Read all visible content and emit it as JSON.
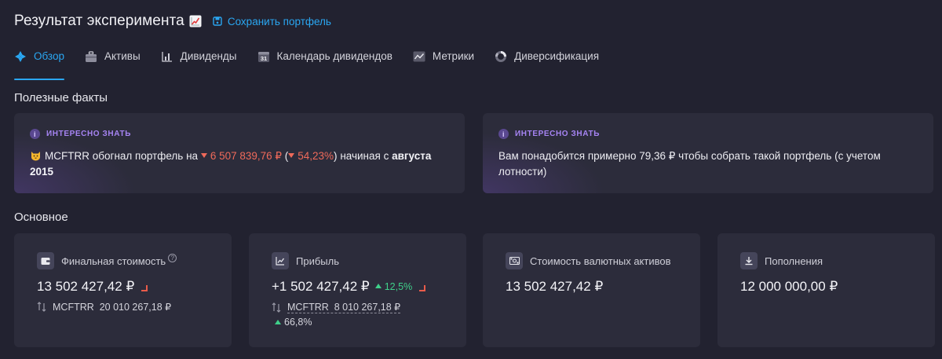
{
  "header": {
    "title": "Результат эксперимента",
    "title_icon": "chart-increasing-emoji",
    "save_label": "Сохранить портфель"
  },
  "tabs": [
    {
      "label": "Обзор",
      "icon": "overview-icon",
      "active": true
    },
    {
      "label": "Активы",
      "icon": "briefcase-icon",
      "active": false
    },
    {
      "label": "Дивиденды",
      "icon": "bar-chart-icon",
      "active": false
    },
    {
      "label": "Календарь дивидендов",
      "icon": "calendar-icon",
      "calendar_day": "31",
      "active": false
    },
    {
      "label": "Метрики",
      "icon": "line-chart-icon",
      "active": false
    },
    {
      "label": "Диверсификация",
      "icon": "donut-chart-icon",
      "active": false
    }
  ],
  "facts": {
    "title": "Полезные факты",
    "cards": [
      {
        "label": "ИНТЕРЕСНО ЗНАТЬ",
        "emoji": "cat-emoji",
        "ticker": "MCFTRR",
        "text1": "обогнал портфель на",
        "amount": "6 507 839,76 ₽",
        "paren_open": "(",
        "percent": "54,23%",
        "paren_close": ")",
        "text2": "начиная с",
        "date": "августа 2015"
      },
      {
        "label": "ИНТЕРЕСНО ЗНАТЬ",
        "text": "Вам понадобится примерно 79,36 ₽ чтобы собрать такой портфель (с учетом лотности)"
      }
    ]
  },
  "main": {
    "title": "Основное",
    "cards": [
      {
        "title": "Финальная стоимость",
        "help": "?",
        "value": "13 502 427,42 ₽",
        "bench_ticker": "MCFTRR",
        "bench_value": "20 010 267,18 ₽"
      },
      {
        "title": "Прибыль",
        "value": "+1 502 427,42 ₽",
        "change": "12,5%",
        "bench_ticker": "MCFTRR",
        "bench_value": "8 010 267,18 ₽",
        "bench_change": "66,8%"
      },
      {
        "title": "Стоимость валютных активов",
        "value": "13 502 427,42 ₽"
      },
      {
        "title": "Пополнения",
        "value": "12 000 000,00 ₽"
      }
    ]
  },
  "colors": {
    "accent": "#2aa7f2",
    "negative": "#ef6a5a",
    "positive": "#3fd08a",
    "info_label": "#a684f3"
  }
}
